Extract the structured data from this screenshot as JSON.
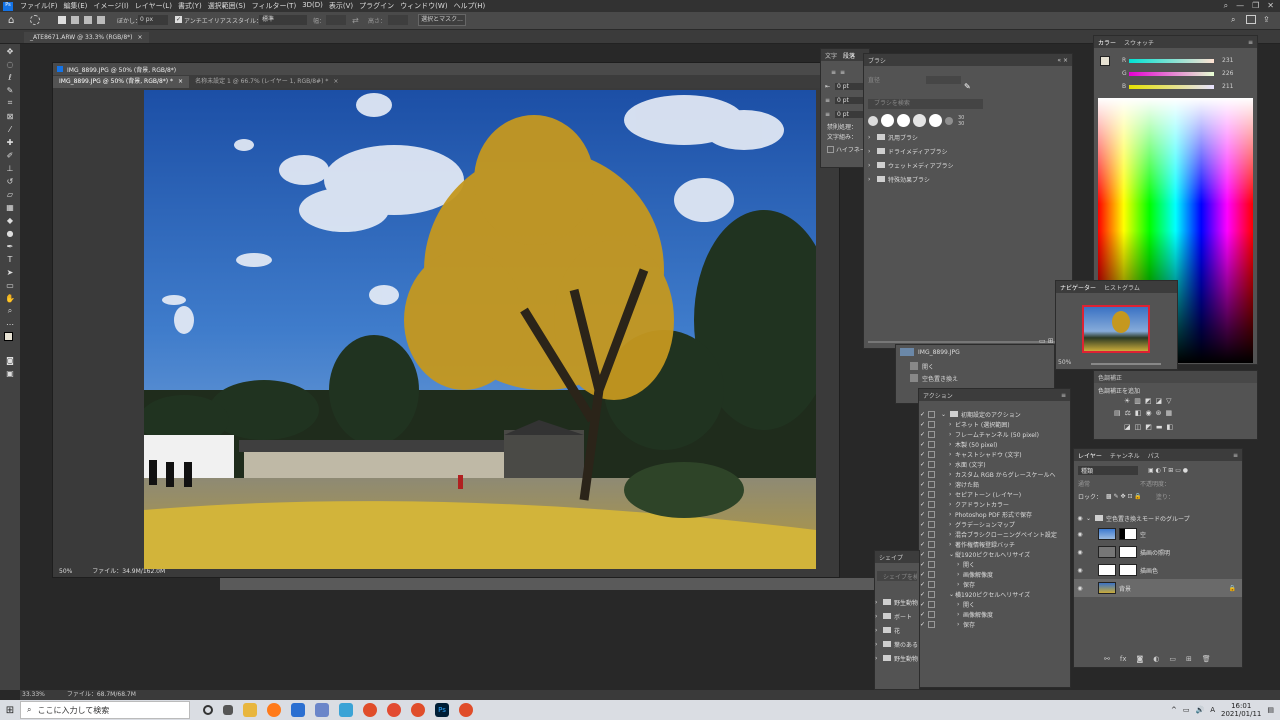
{
  "menu": [
    "ファイル(F)",
    "編集(E)",
    "イメージ(I)",
    "レイヤー(L)",
    "書式(Y)",
    "選択範囲(S)",
    "フィルター(T)",
    "3D(D)",
    "表示(V)",
    "プラグイン",
    "ウィンドウ(W)",
    "ヘルプ(H)"
  ],
  "options": {
    "feather_label": "ぼかし：",
    "feather_value": "0 px",
    "antialias": "アンチエイリアス",
    "style_label": "スタイル：",
    "style_value": "標準",
    "width_label": "幅：",
    "height_label": "高さ：",
    "mask_button": "選択とマスク..."
  },
  "doc": {
    "outer_tab": "_ATE8671.ARW @ 33.3% (RGB/8*)",
    "tab1": "IMG_8899.JPG @ 50% (背景, RGB/8*)",
    "tab2": "IMG_8899.JPG @ 50% (背景, RGB/8*) *",
    "tab3": "名称未設定 1 @ 66.7% (レイヤー 1, RGB/8#) *",
    "zoom": "50%",
    "file_info": "ファイル：34.9M/162.0M",
    "outer_zoom": "33.33%",
    "outer_file": "ファイル：68.7M/68.7M"
  },
  "char_panel": {
    "tab_char": "文字",
    "tab_para": "段落",
    "v1": "0 pt",
    "v2": "0 pt",
    "v3": "0 pt",
    "kinsoku": "禁則処理：",
    "mojikumi": "文字組み：",
    "hyphen": "ハイフネーション"
  },
  "brush_panel": {
    "title": "ブラシ",
    "size_label": "直径",
    "search": "ブラシを検索",
    "size1": "30",
    "size2": "30",
    "groups": [
      "汎用ブラシ",
      "ドライメディアブラシ",
      "ウェットメディアブラシ",
      "特殊効果ブラシ"
    ]
  },
  "history": {
    "snapshot": "IMG_8899.JPG",
    "items": [
      "開く",
      "空色置き換え"
    ]
  },
  "actions": {
    "title": "アクション",
    "items": [
      {
        "label": "初期設定のアクション",
        "indent": 0,
        "expanded": true
      },
      {
        "label": "ビネット (選択範囲)",
        "indent": 1
      },
      {
        "label": "フレームチャンネル (50 pixel)",
        "indent": 1
      },
      {
        "label": "木製 (50 pixel)",
        "indent": 1
      },
      {
        "label": "キャストシャドウ (文字)",
        "indent": 1
      },
      {
        "label": "水面 (文字)",
        "indent": 1
      },
      {
        "label": "カスタム RGB からグレースケールへ",
        "indent": 1
      },
      {
        "label": "溶けた鉛",
        "indent": 1
      },
      {
        "label": "セピアトーン (レイヤー)",
        "indent": 1
      },
      {
        "label": "クアドラントカラー",
        "indent": 1
      },
      {
        "label": "Photoshop PDF 形式で保存",
        "indent": 1
      },
      {
        "label": "グラデーションマップ",
        "indent": 1
      },
      {
        "label": "混合ブラシクローニングペイント設定",
        "indent": 1
      },
      {
        "label": "著作権情報登録バッチ",
        "indent": 1
      },
      {
        "label": "縦1920ピクセルへリサイズ",
        "indent": 1,
        "expanded": true
      },
      {
        "label": "開く",
        "indent": 2
      },
      {
        "label": "画像解像度",
        "indent": 2
      },
      {
        "label": "保存",
        "indent": 2
      },
      {
        "label": "横1920ピクセルへリサイズ",
        "indent": 1,
        "expanded": true
      },
      {
        "label": "開く",
        "indent": 2
      },
      {
        "label": "画像解像度",
        "indent": 2
      },
      {
        "label": "保存",
        "indent": 2
      }
    ]
  },
  "shapes": {
    "title": "シェイプ",
    "search": "シェイプを検索",
    "items": [
      "野生動物",
      "ボート",
      "花",
      "葉のある",
      "野生動物"
    ]
  },
  "color": {
    "tab1": "カラー",
    "tab2": "スウォッチ",
    "r": "231",
    "g": "226",
    "b": "211",
    "r_label": "R",
    "g_label": "G",
    "b_label": "B"
  },
  "navigator": {
    "tab1": "ナビゲーター",
    "tab2": "ヒストグラム",
    "zoom": "50%"
  },
  "adjust": {
    "tab": "色調補正",
    "label": "色調補正を追加"
  },
  "layers": {
    "tab1": "レイヤー",
    "tab2": "チャンネル",
    "tab3": "パス",
    "kind": "種類",
    "mode": "通常",
    "opacity_label": "不透明度：",
    "lock": "ロック：",
    "fill_label": "塗り：",
    "items": [
      {
        "name": "空色置き換えモードのグループ",
        "type": "group"
      },
      {
        "name": "空",
        "type": "sky"
      },
      {
        "name": "描画の照明",
        "type": "light"
      },
      {
        "name": "描画色",
        "type": "fill"
      },
      {
        "name": "背景",
        "type": "bg"
      }
    ]
  },
  "taskbar": {
    "search": "ここに入力して検索",
    "time": "16:01",
    "date": "2021/01/11",
    "ime": "A"
  },
  "accent": "#2d8cf0"
}
